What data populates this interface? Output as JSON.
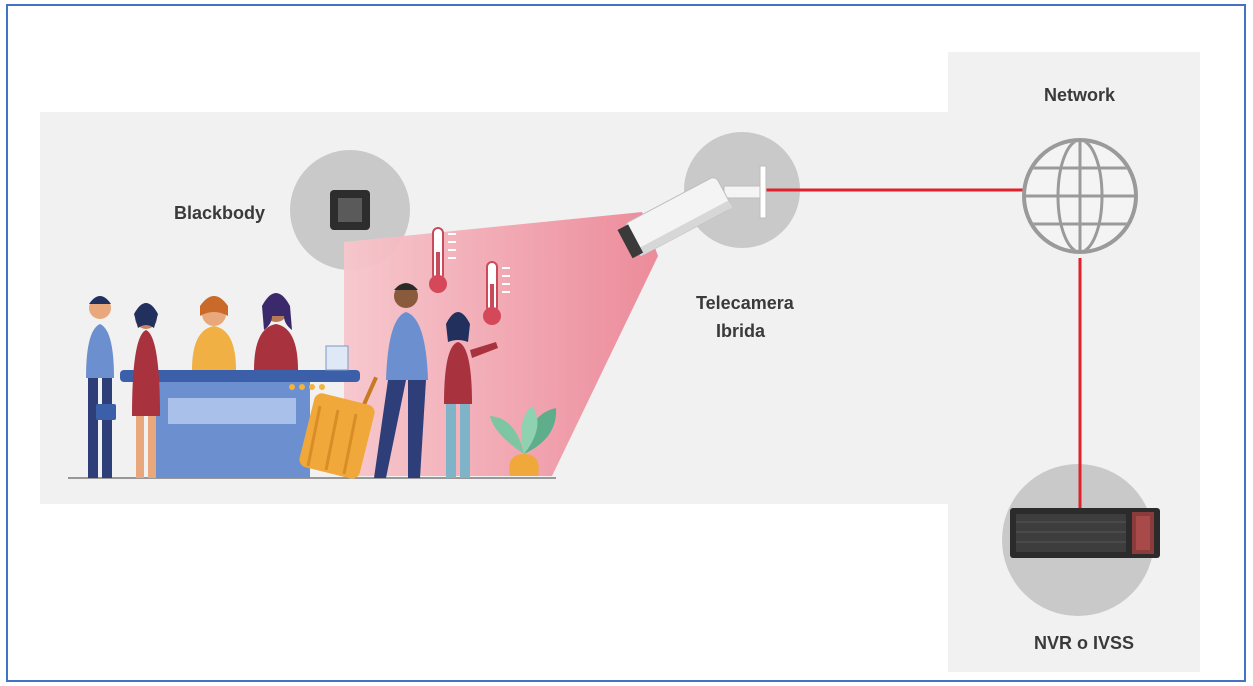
{
  "diagram": {
    "labels": {
      "blackbody": "Blackbody",
      "camera_line1": "Telecamera",
      "camera_line2": "Ibrida",
      "network": "Network",
      "recorder": "NVR o IVSS"
    },
    "colors": {
      "frame_border": "#4472c4",
      "panel": "#f1f1f1",
      "circle": "#c9c9c9",
      "link_line": "#e0212b",
      "detection_zone_start": "#f7c6cc",
      "detection_zone_end": "#ec8696"
    },
    "icons": [
      "blackbody-icon",
      "camera-icon",
      "globe-icon",
      "server-icon",
      "thermometer-icon",
      "suitcase-icon",
      "plant-icon"
    ]
  }
}
